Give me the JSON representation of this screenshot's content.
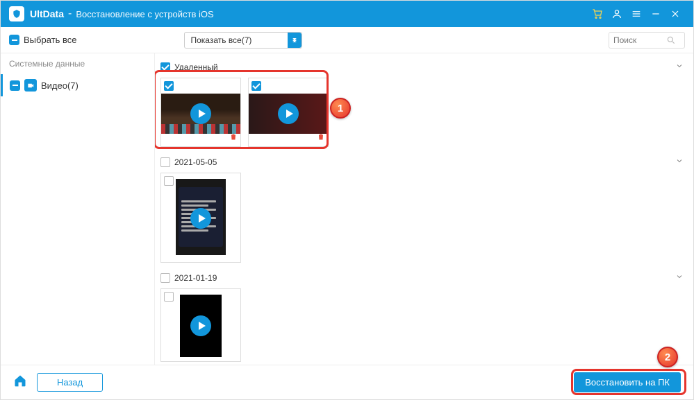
{
  "titlebar": {
    "app_name": "UltData",
    "separator": "-",
    "subtitle": "Восстановление с устройств iOS"
  },
  "toolbar": {
    "select_all": "Выбрать все",
    "filter": "Показать все(7)",
    "search_placeholder": "Поиск"
  },
  "sidebar": {
    "header": "Системные данные",
    "items": [
      {
        "label": "Видео(7)"
      }
    ]
  },
  "groups": [
    {
      "title": "Удаленный",
      "checked": true
    },
    {
      "title": "2021-05-05",
      "checked": false
    },
    {
      "title": "2021-01-19",
      "checked": false
    }
  ],
  "footer": {
    "back": "Назад",
    "recover": "Восстановить на ПК"
  },
  "annotations": {
    "badge1": "1",
    "badge2": "2"
  }
}
